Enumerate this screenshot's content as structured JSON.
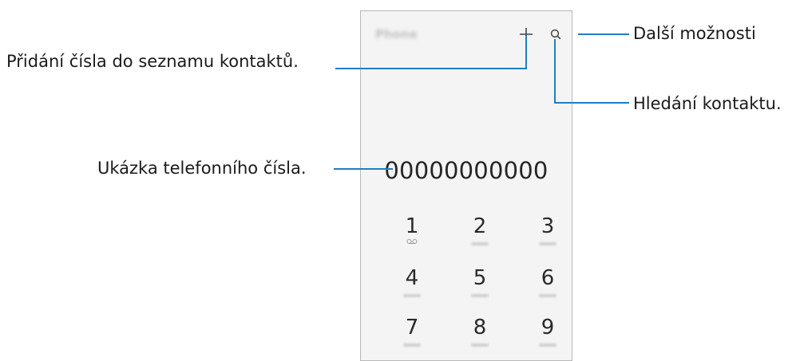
{
  "app": {
    "title": "Phone"
  },
  "display": {
    "number": "00000000000"
  },
  "keypad": [
    {
      "digit": "1",
      "sub": "voicemail"
    },
    {
      "digit": "2",
      "sub": ""
    },
    {
      "digit": "3",
      "sub": ""
    },
    {
      "digit": "4",
      "sub": ""
    },
    {
      "digit": "5",
      "sub": ""
    },
    {
      "digit": "6",
      "sub": ""
    },
    {
      "digit": "7",
      "sub": ""
    },
    {
      "digit": "8",
      "sub": ""
    },
    {
      "digit": "9",
      "sub": ""
    }
  ],
  "callouts": {
    "more_options": "Další možnosti",
    "add_contact": "Přidání čísla do seznamu kontaktů.",
    "search_contact": "Hledání kontaktu.",
    "number_preview": "Ukázka telefonního čísla."
  },
  "colors": {
    "callout_line": "#1f7fc0",
    "screen_bg": "#f4f4f4"
  }
}
